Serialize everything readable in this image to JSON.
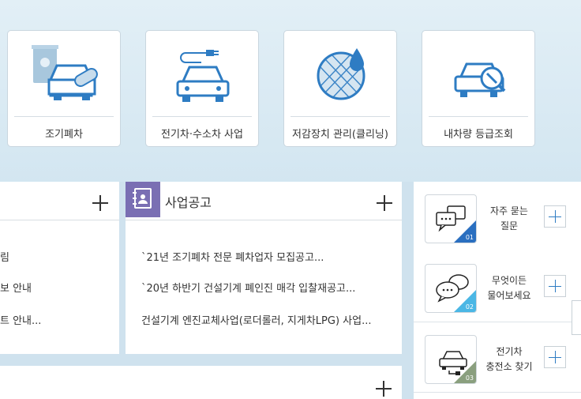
{
  "services": [
    {
      "label": "조기폐차",
      "icon": "early-scrap-car-icon"
    },
    {
      "label": "전기차·수소차 사업",
      "icon": "electric-car-plug-icon"
    },
    {
      "label": "저감장치 관리(클리닝)",
      "icon": "filter-cleaning-icon"
    },
    {
      "label": "내차량 등급조회",
      "icon": "car-search-icon"
    }
  ],
  "left_panel": {
    "items": [
      "림",
      "보 안내",
      "트 안내..."
    ]
  },
  "notice": {
    "title": "사업공고",
    "items": [
      "`21년 조기폐차 전문 폐차업자 모집공고...",
      "`20년 하반기 건설기계 폐인진 매각 입찰재공고...",
      "건설기계 엔진교체사업(로더롤러, 지게차LPG) 사업..."
    ]
  },
  "faq": [
    {
      "line1": "자주 묻는",
      "line2": "질문",
      "num": "01",
      "color": "#2a6fc0",
      "icon": "chat-bubbles-icon"
    },
    {
      "line1": "무엇이든",
      "line2": "물어보세요",
      "num": "02",
      "color": "#4bb7e5",
      "icon": "speech-bubbles-icon"
    },
    {
      "line1": "전기차",
      "line2": "충전소 찾기",
      "num": "03",
      "color": "#8a9f7e",
      "icon": "ev-charging-car-icon"
    }
  ]
}
